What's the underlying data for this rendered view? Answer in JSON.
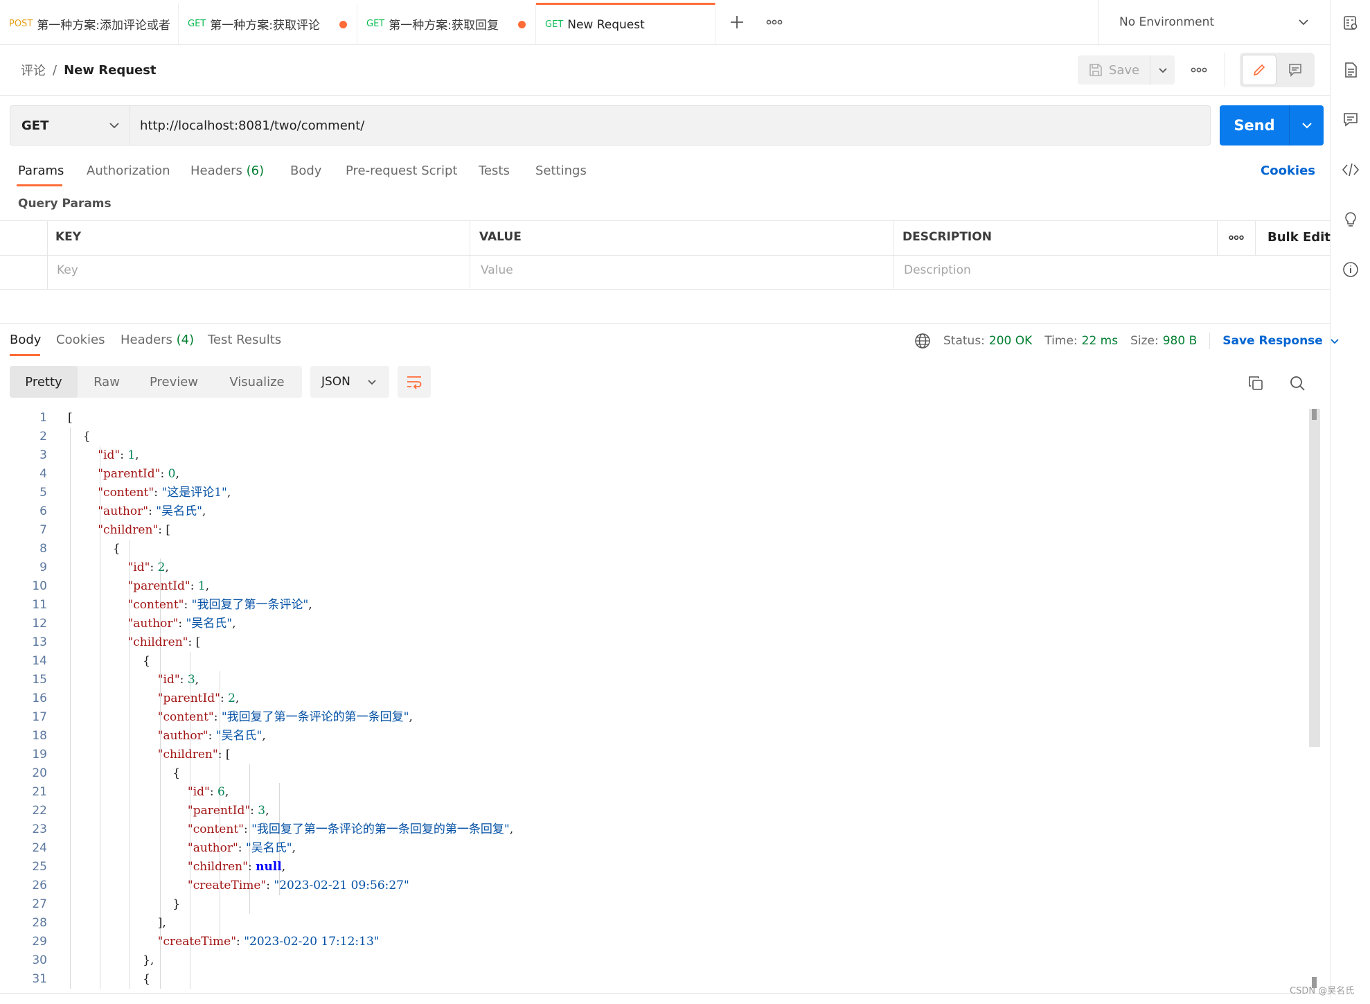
{
  "tabs": [
    {
      "method": "POST",
      "name": "第一种方案:添加评论或者",
      "unsaved": false,
      "active": false
    },
    {
      "method": "GET",
      "name": "第一种方案:获取评论",
      "unsaved": true,
      "active": false
    },
    {
      "method": "GET",
      "name": "第一种方案:获取回复",
      "unsaved": true,
      "active": false
    },
    {
      "method": "GET",
      "name": "New Request",
      "unsaved": false,
      "active": true
    }
  ],
  "environment": {
    "selected": "No Environment"
  },
  "breadcrumb": {
    "collection": "评论",
    "separator": "/",
    "request": "New Request"
  },
  "toolbar": {
    "save_label": "Save"
  },
  "request": {
    "method": "GET",
    "url": "http://localhost:8081/two/comment/",
    "send_label": "Send"
  },
  "request_tabs": {
    "params": "Params",
    "authorization": "Authorization",
    "headers": "Headers",
    "headers_count": "(6)",
    "body": "Body",
    "prerequest": "Pre-request Script",
    "tests": "Tests",
    "settings": "Settings",
    "cookies": "Cookies"
  },
  "params": {
    "section_title": "Query Params",
    "col_key": "KEY",
    "col_value": "VALUE",
    "col_description": "DESCRIPTION",
    "bulk_edit": "Bulk Edit",
    "placeholder_key": "Key",
    "placeholder_value": "Value",
    "placeholder_description": "Description"
  },
  "response_tabs": {
    "body": "Body",
    "cookies": "Cookies",
    "headers": "Headers",
    "headers_count": "(4)",
    "test_results": "Test Results"
  },
  "response_meta": {
    "status_label": "Status:",
    "status_value": "200 OK",
    "time_label": "Time:",
    "time_value": "22 ms",
    "size_label": "Size:",
    "size_value": "980 B",
    "save_response": "Save Response"
  },
  "view_modes": {
    "pretty": "Pretty",
    "raw": "Raw",
    "preview": "Preview",
    "visualize": "Visualize",
    "format": "JSON"
  },
  "code_lines": [
    [
      {
        "t": "p",
        "v": "["
      }
    ],
    [
      {
        "t": "p",
        "v": "    {"
      }
    ],
    [
      {
        "t": "p",
        "v": "        "
      },
      {
        "t": "k",
        "v": "\"id\""
      },
      {
        "t": "p",
        "v": ": "
      },
      {
        "t": "n",
        "v": "1"
      },
      {
        "t": "p",
        "v": ","
      }
    ],
    [
      {
        "t": "p",
        "v": "        "
      },
      {
        "t": "k",
        "v": "\"parentId\""
      },
      {
        "t": "p",
        "v": ": "
      },
      {
        "t": "n",
        "v": "0"
      },
      {
        "t": "p",
        "v": ","
      }
    ],
    [
      {
        "t": "p",
        "v": "        "
      },
      {
        "t": "k",
        "v": "\"content\""
      },
      {
        "t": "p",
        "v": ": "
      },
      {
        "t": "s",
        "v": "\"这是评论1\""
      },
      {
        "t": "p",
        "v": ","
      }
    ],
    [
      {
        "t": "p",
        "v": "        "
      },
      {
        "t": "k",
        "v": "\"author\""
      },
      {
        "t": "p",
        "v": ": "
      },
      {
        "t": "s",
        "v": "\"吴名氏\""
      },
      {
        "t": "p",
        "v": ","
      }
    ],
    [
      {
        "t": "p",
        "v": "        "
      },
      {
        "t": "k",
        "v": "\"children\""
      },
      {
        "t": "p",
        "v": ": ["
      }
    ],
    [
      {
        "t": "p",
        "v": "            {"
      }
    ],
    [
      {
        "t": "p",
        "v": "                "
      },
      {
        "t": "k",
        "v": "\"id\""
      },
      {
        "t": "p",
        "v": ": "
      },
      {
        "t": "n",
        "v": "2"
      },
      {
        "t": "p",
        "v": ","
      }
    ],
    [
      {
        "t": "p",
        "v": "                "
      },
      {
        "t": "k",
        "v": "\"parentId\""
      },
      {
        "t": "p",
        "v": ": "
      },
      {
        "t": "n",
        "v": "1"
      },
      {
        "t": "p",
        "v": ","
      }
    ],
    [
      {
        "t": "p",
        "v": "                "
      },
      {
        "t": "k",
        "v": "\"content\""
      },
      {
        "t": "p",
        "v": ": "
      },
      {
        "t": "s",
        "v": "\"我回复了第一条评论\""
      },
      {
        "t": "p",
        "v": ","
      }
    ],
    [
      {
        "t": "p",
        "v": "                "
      },
      {
        "t": "k",
        "v": "\"author\""
      },
      {
        "t": "p",
        "v": ": "
      },
      {
        "t": "s",
        "v": "\"吴名氏\""
      },
      {
        "t": "p",
        "v": ","
      }
    ],
    [
      {
        "t": "p",
        "v": "                "
      },
      {
        "t": "k",
        "v": "\"children\""
      },
      {
        "t": "p",
        "v": ": ["
      }
    ],
    [
      {
        "t": "p",
        "v": "                    {"
      }
    ],
    [
      {
        "t": "p",
        "v": "                        "
      },
      {
        "t": "k",
        "v": "\"id\""
      },
      {
        "t": "p",
        "v": ": "
      },
      {
        "t": "n",
        "v": "3"
      },
      {
        "t": "p",
        "v": ","
      }
    ],
    [
      {
        "t": "p",
        "v": "                        "
      },
      {
        "t": "k",
        "v": "\"parentId\""
      },
      {
        "t": "p",
        "v": ": "
      },
      {
        "t": "n",
        "v": "2"
      },
      {
        "t": "p",
        "v": ","
      }
    ],
    [
      {
        "t": "p",
        "v": "                        "
      },
      {
        "t": "k",
        "v": "\"content\""
      },
      {
        "t": "p",
        "v": ": "
      },
      {
        "t": "s",
        "v": "\"我回复了第一条评论的第一条回复\""
      },
      {
        "t": "p",
        "v": ","
      }
    ],
    [
      {
        "t": "p",
        "v": "                        "
      },
      {
        "t": "k",
        "v": "\"author\""
      },
      {
        "t": "p",
        "v": ": "
      },
      {
        "t": "s",
        "v": "\"吴名氏\""
      },
      {
        "t": "p",
        "v": ","
      }
    ],
    [
      {
        "t": "p",
        "v": "                        "
      },
      {
        "t": "k",
        "v": "\"children\""
      },
      {
        "t": "p",
        "v": ": ["
      }
    ],
    [
      {
        "t": "p",
        "v": "                            {"
      }
    ],
    [
      {
        "t": "p",
        "v": "                                "
      },
      {
        "t": "k",
        "v": "\"id\""
      },
      {
        "t": "p",
        "v": ": "
      },
      {
        "t": "n",
        "v": "6"
      },
      {
        "t": "p",
        "v": ","
      }
    ],
    [
      {
        "t": "p",
        "v": "                                "
      },
      {
        "t": "k",
        "v": "\"parentId\""
      },
      {
        "t": "p",
        "v": ": "
      },
      {
        "t": "n",
        "v": "3"
      },
      {
        "t": "p",
        "v": ","
      }
    ],
    [
      {
        "t": "p",
        "v": "                                "
      },
      {
        "t": "k",
        "v": "\"content\""
      },
      {
        "t": "p",
        "v": ": "
      },
      {
        "t": "s",
        "v": "\"我回复了第一条评论的第一条回复的第一条回复\""
      },
      {
        "t": "p",
        "v": ","
      }
    ],
    [
      {
        "t": "p",
        "v": "                                "
      },
      {
        "t": "k",
        "v": "\"author\""
      },
      {
        "t": "p",
        "v": ": "
      },
      {
        "t": "s",
        "v": "\"吴名氏\""
      },
      {
        "t": "p",
        "v": ","
      }
    ],
    [
      {
        "t": "p",
        "v": "                                "
      },
      {
        "t": "k",
        "v": "\"children\""
      },
      {
        "t": "p",
        "v": ": "
      },
      {
        "t": "nl",
        "v": "null"
      },
      {
        "t": "p",
        "v": ","
      }
    ],
    [
      {
        "t": "p",
        "v": "                                "
      },
      {
        "t": "k",
        "v": "\"createTime\""
      },
      {
        "t": "p",
        "v": ": "
      },
      {
        "t": "s",
        "v": "\"2023-02-21 09:56:27\""
      }
    ],
    [
      {
        "t": "p",
        "v": "                            }"
      }
    ],
    [
      {
        "t": "p",
        "v": "                        ],"
      }
    ],
    [
      {
        "t": "p",
        "v": "                        "
      },
      {
        "t": "k",
        "v": "\"createTime\""
      },
      {
        "t": "p",
        "v": ": "
      },
      {
        "t": "s",
        "v": "\"2023-02-20 17:12:13\""
      }
    ],
    [
      {
        "t": "p",
        "v": "                    },"
      }
    ],
    [
      {
        "t": "p",
        "v": "                    {"
      }
    ]
  ],
  "watermark": "CSDN @吴名氏",
  "colors": {
    "accent": "#ff6c37",
    "primary": "#097bed",
    "link": "#0265d2",
    "success": "#007f31"
  }
}
